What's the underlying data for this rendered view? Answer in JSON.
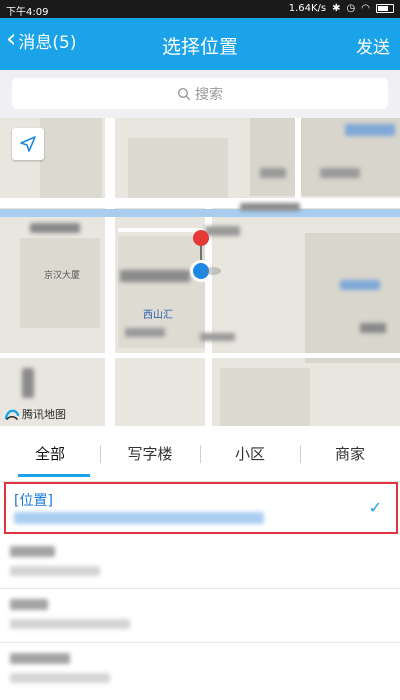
{
  "status_bar": {
    "time": "下午4:09",
    "speed": "1.64K/s"
  },
  "header": {
    "back_label": "消息(5)",
    "title": "选择位置",
    "send_label": "发送"
  },
  "search": {
    "placeholder": "搜索"
  },
  "map": {
    "poi_label": "西山汇",
    "building_label": "京汉大厦",
    "logo_text": "腾讯地图"
  },
  "tabs": [
    {
      "label": "全部",
      "active": true
    },
    {
      "label": "写字楼",
      "active": false
    },
    {
      "label": "小区",
      "active": false
    },
    {
      "label": "商家",
      "active": false
    }
  ],
  "results": {
    "selected": {
      "name": "[位置]",
      "check": "✓"
    }
  },
  "colors": {
    "accent": "#1aa3e8",
    "selection_border": "#e0333f",
    "pin_red": "#e53935",
    "pin_blue": "#1e88e5"
  }
}
